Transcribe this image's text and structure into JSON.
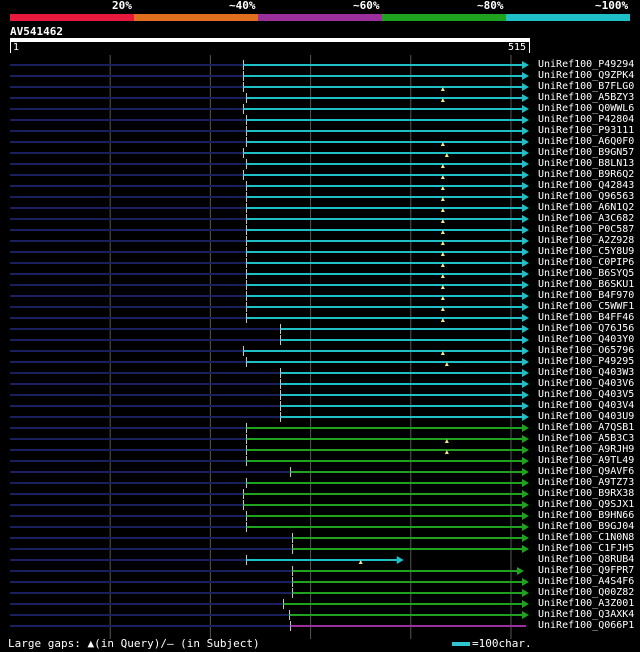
{
  "legend": {
    "segments": [
      {
        "label": "20%",
        "color": "#e8193c"
      },
      {
        "label": "~40%",
        "color": "#e07020"
      },
      {
        "label": "~60%",
        "color": "#9b2f9b"
      },
      {
        "label": "~80%",
        "color": "#1fa31f"
      },
      {
        "label": "~100%",
        "color": "#1fbfc8"
      }
    ]
  },
  "query": {
    "id": "AV541462",
    "start_label": "1",
    "end_label": "515",
    "length": 515
  },
  "hits": [
    {
      "name": "UniRef100_P49294",
      "start": 233,
      "end": 515,
      "color": "#1fbfc8",
      "arrow": "right",
      "gap": null
    },
    {
      "name": "UniRef100_Q9ZPK4",
      "start": 233,
      "end": 515,
      "color": "#1fbfc8",
      "arrow": "right",
      "gap": null
    },
    {
      "name": "UniRef100_B7FLG0",
      "start": 233,
      "end": 515,
      "color": "#1fbfc8",
      "arrow": "right",
      "gap": 432
    },
    {
      "name": "UniRef100_A5BZY3",
      "start": 236,
      "end": 515,
      "color": "#1fbfc8",
      "arrow": "right",
      "gap": 432
    },
    {
      "name": "UniRef100_Q0WWL6",
      "start": 233,
      "end": 515,
      "color": "#1fbfc8",
      "arrow": "right",
      "gap": null
    },
    {
      "name": "UniRef100_P42804",
      "start": 236,
      "end": 515,
      "color": "#1fbfc8",
      "arrow": "right",
      "gap": null
    },
    {
      "name": "UniRef100_P93111",
      "start": 236,
      "end": 515,
      "color": "#1fbfc8",
      "arrow": "right",
      "gap": null
    },
    {
      "name": "UniRef100_A6Q0F0",
      "start": 236,
      "end": 515,
      "color": "#1fbfc8",
      "arrow": "right",
      "gap": 432
    },
    {
      "name": "UniRef100_B9GN57",
      "start": 233,
      "end": 515,
      "color": "#1fbfc8",
      "arrow": "right",
      "gap": 436
    },
    {
      "name": "UniRef100_B8LN13",
      "start": 236,
      "end": 515,
      "color": "#1fbfc8",
      "arrow": "right",
      "gap": 432
    },
    {
      "name": "UniRef100_B9R6Q2",
      "start": 233,
      "end": 515,
      "color": "#1fbfc8",
      "arrow": "right",
      "gap": 432
    },
    {
      "name": "UniRef100_Q42843",
      "start": 236,
      "end": 515,
      "color": "#1fbfc8",
      "arrow": "right",
      "gap": 432
    },
    {
      "name": "UniRef100_Q96563",
      "start": 236,
      "end": 515,
      "color": "#1fbfc8",
      "arrow": "right",
      "gap": 432
    },
    {
      "name": "UniRef100_A6N1Q2",
      "start": 236,
      "end": 515,
      "color": "#1fbfc8",
      "arrow": "right",
      "gap": 432
    },
    {
      "name": "UniRef100_A3C682",
      "start": 236,
      "end": 515,
      "color": "#1fbfc8",
      "arrow": "right",
      "gap": 432
    },
    {
      "name": "UniRef100_P0C587",
      "start": 236,
      "end": 515,
      "color": "#1fbfc8",
      "arrow": "right",
      "gap": 432
    },
    {
      "name": "UniRef100_A2Z928",
      "start": 236,
      "end": 515,
      "color": "#1fbfc8",
      "arrow": "right",
      "gap": 432
    },
    {
      "name": "UniRef100_C5Y8U9",
      "start": 236,
      "end": 515,
      "color": "#1fbfc8",
      "arrow": "right",
      "gap": 432
    },
    {
      "name": "UniRef100_C0PIP6",
      "start": 236,
      "end": 515,
      "color": "#1fbfc8",
      "arrow": "right",
      "gap": 432
    },
    {
      "name": "UniRef100_B6SYQ5",
      "start": 236,
      "end": 515,
      "color": "#1fbfc8",
      "arrow": "right",
      "gap": 432
    },
    {
      "name": "UniRef100_B6SKU1",
      "start": 236,
      "end": 515,
      "color": "#1fbfc8",
      "arrow": "right",
      "gap": 432
    },
    {
      "name": "UniRef100_B4F970",
      "start": 236,
      "end": 515,
      "color": "#1fbfc8",
      "arrow": "right",
      "gap": 432
    },
    {
      "name": "UniRef100_C5WWF1",
      "start": 236,
      "end": 515,
      "color": "#1fbfc8",
      "arrow": "right",
      "gap": 432
    },
    {
      "name": "UniRef100_B4FF46",
      "start": 236,
      "end": 515,
      "color": "#1fbfc8",
      "arrow": "right",
      "gap": 432
    },
    {
      "name": "UniRef100_Q76J56",
      "start": 270,
      "end": 515,
      "color": "#1fbfc8",
      "arrow": "right",
      "gap": null
    },
    {
      "name": "UniRef100_Q403Y0",
      "start": 270,
      "end": 515,
      "color": "#1fbfc8",
      "arrow": "right",
      "gap": null
    },
    {
      "name": "UniRef100_O65796",
      "start": 233,
      "end": 515,
      "color": "#1fbfc8",
      "arrow": "right",
      "gap": 432
    },
    {
      "name": "UniRef100_P49295",
      "start": 236,
      "end": 515,
      "color": "#1fbfc8",
      "arrow": "right",
      "gap": 436
    },
    {
      "name": "UniRef100_Q403W3",
      "start": 270,
      "end": 515,
      "color": "#1fbfc8",
      "arrow": "right",
      "gap": null
    },
    {
      "name": "UniRef100_Q403V6",
      "start": 270,
      "end": 515,
      "color": "#1fbfc8",
      "arrow": "right",
      "gap": null
    },
    {
      "name": "UniRef100_Q403V5",
      "start": 270,
      "end": 515,
      "color": "#1fbfc8",
      "arrow": "right",
      "gap": null
    },
    {
      "name": "UniRef100_Q403V4",
      "start": 270,
      "end": 515,
      "color": "#1fbfc8",
      "arrow": "right",
      "gap": null
    },
    {
      "name": "UniRef100_Q403U9",
      "start": 270,
      "end": 515,
      "color": "#1fbfc8",
      "arrow": "right",
      "gap": null
    },
    {
      "name": "UniRef100_A7QSB1",
      "start": 236,
      "end": 515,
      "color": "#1fa31f",
      "arrow": "right",
      "gap": null
    },
    {
      "name": "UniRef100_A5B3C3",
      "start": 236,
      "end": 515,
      "color": "#1fa31f",
      "arrow": "right",
      "gap": 436
    },
    {
      "name": "UniRef100_A9RJH9",
      "start": 236,
      "end": 515,
      "color": "#1fa31f",
      "arrow": "right",
      "gap": 436
    },
    {
      "name": "UniRef100_A9TL49",
      "start": 236,
      "end": 515,
      "color": "#1fa31f",
      "arrow": "right",
      "gap": null
    },
    {
      "name": "UniRef100_Q9AVF6",
      "start": 280,
      "end": 515,
      "color": "#1fa31f",
      "arrow": "right",
      "gap": null
    },
    {
      "name": "UniRef100_A9TZ73",
      "start": 236,
      "end": 515,
      "color": "#1fa31f",
      "arrow": "right",
      "gap": null
    },
    {
      "name": "UniRef100_B9RX38",
      "start": 233,
      "end": 515,
      "color": "#1fa31f",
      "arrow": "right",
      "gap": null
    },
    {
      "name": "UniRef100_Q9SJX1",
      "start": 233,
      "end": 515,
      "color": "#1fa31f",
      "arrow": "right",
      "gap": null
    },
    {
      "name": "UniRef100_B9HN66",
      "start": 236,
      "end": 515,
      "color": "#1fa31f",
      "arrow": "right",
      "gap": null
    },
    {
      "name": "UniRef100_B9GJ04",
      "start": 236,
      "end": 515,
      "color": "#1fa31f",
      "arrow": "right",
      "gap": null
    },
    {
      "name": "UniRef100_C1N0N8",
      "start": 282,
      "end": 515,
      "color": "#1fa31f",
      "arrow": "right",
      "gap": null
    },
    {
      "name": "UniRef100_C1FJH5",
      "start": 282,
      "end": 515,
      "color": "#1fa31f",
      "arrow": "right",
      "gap": null
    },
    {
      "name": "UniRef100_Q8RUB4",
      "start": 236,
      "end": 390,
      "color": "#1fbfc8",
      "arrow": "right",
      "gap": 350
    },
    {
      "name": "UniRef100_Q9FPR7",
      "start": 282,
      "end": 510,
      "color": "#1fa31f",
      "arrow": "right",
      "gap": null
    },
    {
      "name": "UniRef100_A4S4F6",
      "start": 282,
      "end": 515,
      "color": "#1fa31f",
      "arrow": "right",
      "gap": null
    },
    {
      "name": "UniRef100_Q00Z82",
      "start": 282,
      "end": 515,
      "color": "#1fa31f",
      "arrow": "right",
      "gap": null
    },
    {
      "name": "UniRef100_A3Z001",
      "start": 273,
      "end": 515,
      "color": "#1fa31f",
      "arrow": "right",
      "gap": null
    },
    {
      "name": "UniRef100_Q3AXK4",
      "start": 279,
      "end": 515,
      "color": "#1fa31f",
      "arrow": "right",
      "gap": null
    },
    {
      "name": "UniRef100_Q066P1",
      "start": 280,
      "end": 515,
      "color": "#9b2f9b",
      "arrow": "none",
      "gap": null
    }
  ],
  "footer": {
    "gaps_text": "Large gaps: ▲(in Query)/— (in Subject)",
    "scale_text": "=100char."
  },
  "colors": {
    "unaligned": "#1a1f5e",
    "grid": "#555555",
    "gap_marker": "#f0e68c"
  }
}
